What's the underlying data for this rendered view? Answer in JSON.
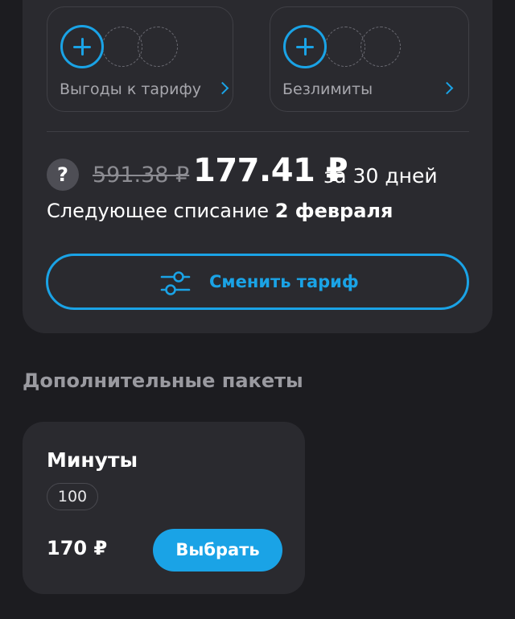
{
  "options": {
    "benefits_label": "Выгоды к тарифу",
    "unlimited_label": "Безлимиты"
  },
  "pricing": {
    "help_symbol": "?",
    "old_price": "591.38 ₽",
    "new_price": "177.41 ₽",
    "period": "за 30 дней",
    "next_charge_prefix": "Следующее списание ",
    "next_charge_date": "2 февраля"
  },
  "actions": {
    "change_tariff_label": "Сменить тариф"
  },
  "extras": {
    "section_title": "Дополнительные пакеты",
    "package": {
      "title": "Минуты",
      "amount": "100",
      "price": "170 ₽",
      "select_label": "Выбрать"
    }
  },
  "colors": {
    "accent": "#1aa3e6",
    "background": "#1c1c20",
    "card": "#2a2a2f"
  }
}
